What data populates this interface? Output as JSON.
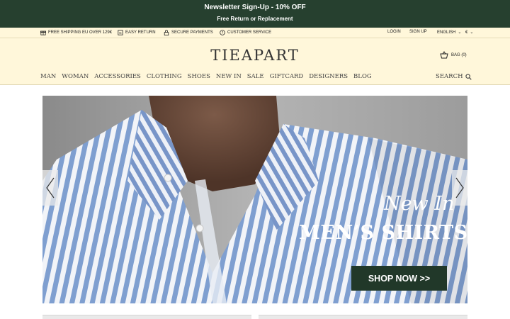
{
  "promo": {
    "headline": "Newsletter Sign-Up - 10% OFF",
    "subline": "Free Return or Replacement"
  },
  "utility": {
    "items": [
      {
        "label": "FREE SHIPPING EU OVER 129€",
        "icon": "gift-icon"
      },
      {
        "label": "EASY RETURN",
        "icon": "return-icon"
      },
      {
        "label": "SECURE PAYMENTS",
        "icon": "lock-icon"
      },
      {
        "label": "CUSTOMER SERVICE",
        "icon": "question-icon"
      }
    ],
    "login": "LOGIN",
    "signup": "SIGN UP",
    "language": "ENGLISH",
    "currency": "€"
  },
  "header": {
    "logo": "TIEAPART",
    "bag": "BAG (0)",
    "search": "SEARCH"
  },
  "nav": [
    "MAN",
    "WOMAN",
    "ACCESSORIES",
    "CLOTHING",
    "SHOES",
    "NEW IN",
    "SALE",
    "GIFTCARD",
    "DESIGNERS",
    "BLOG"
  ],
  "hero": {
    "caption_top": "New In",
    "caption_main": "MEN’S SHIRTS",
    "cta": "SHOP NOW >>",
    "colors": {
      "stripe_blue": "#7f9fd0",
      "stripe_white": "#f2f4f8",
      "cta_bg": "#213829"
    }
  },
  "colors": {
    "promo_bg": "#26402f",
    "header_bg": "#fff7da"
  }
}
